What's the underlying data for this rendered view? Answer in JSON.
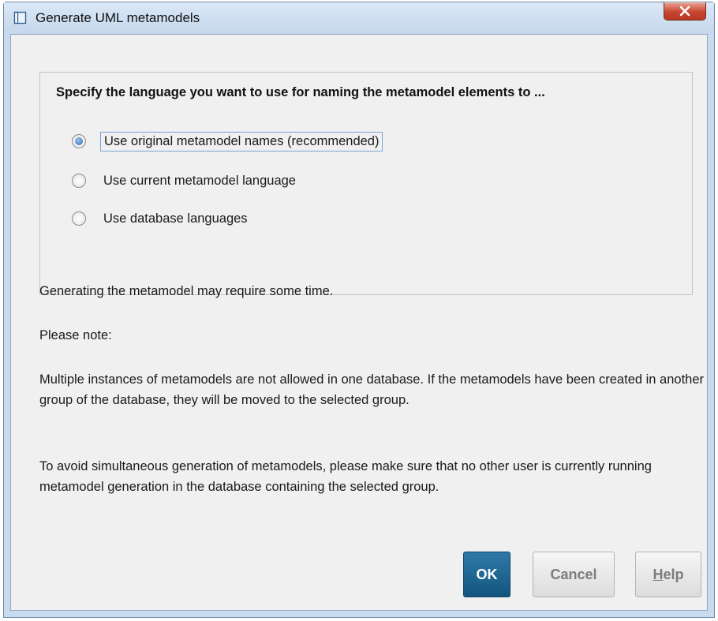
{
  "window": {
    "title": "Generate UML metamodels",
    "title_icon": "window-icon",
    "close_icon": "close-icon"
  },
  "language_group": {
    "heading": "Specify the language you want to use for naming the metamodel elements to ...",
    "options": [
      {
        "label": "Use original metamodel names (recommended)",
        "selected": true
      },
      {
        "label": "Use current metamodel language",
        "selected": false
      },
      {
        "label": "Use database languages",
        "selected": false
      }
    ]
  },
  "info": {
    "time_note": "Generating the metamodel may require some time.",
    "please_note": "Please note:",
    "instances_note": "Multiple instances of metamodels are not allowed in one database. If the metamodels have been created in another group of the database, they will be moved to the selected group.",
    "simultaneous_note": "To avoid simultaneous generation of metamodels, please make sure that no other user is currently running metamodel generation in the database containing the selected group."
  },
  "buttons": {
    "ok": "OK",
    "cancel": "Cancel",
    "help_mnemonic": "H",
    "help_rest": "elp"
  },
  "colors": {
    "ok_button": "#1b5e8a",
    "close_button": "#c7442f",
    "title_bar": "#c9dbee",
    "dialog_bg": "#f0f0f0"
  }
}
